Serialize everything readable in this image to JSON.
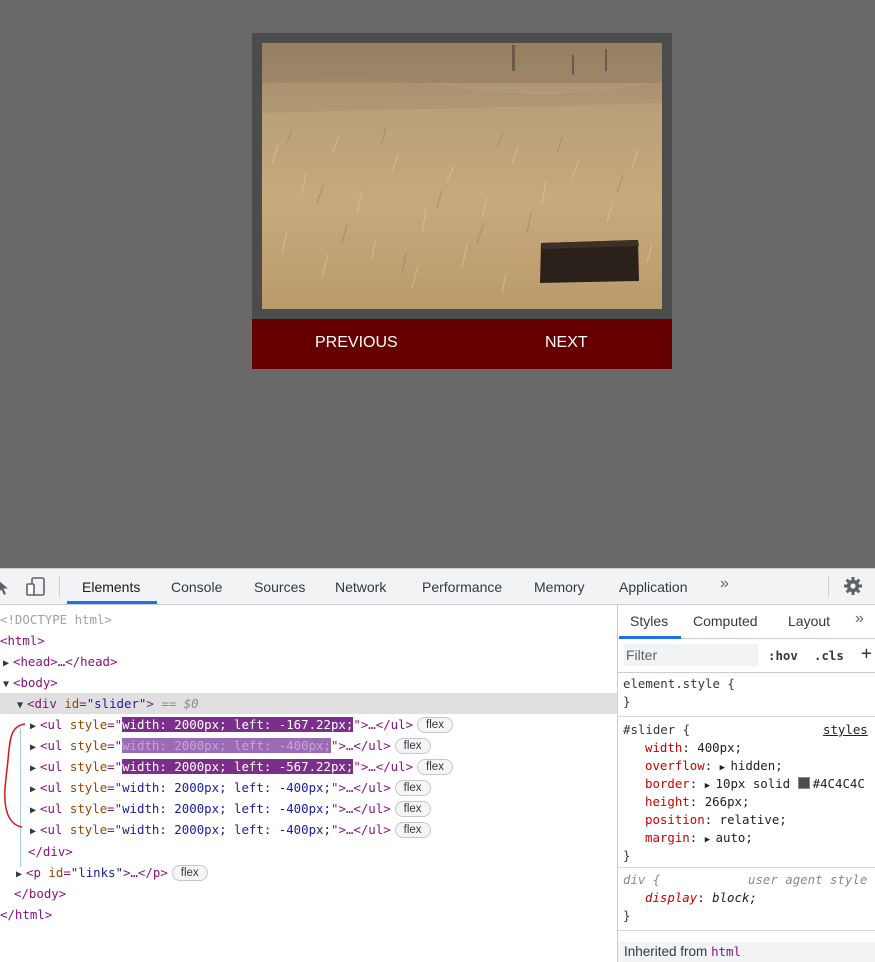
{
  "page": {
    "background_color": "#696969",
    "slider_border_color": "#4C4C4C",
    "links_background": "#660000",
    "prev_label": "PREVIOUS",
    "next_label": "NEXT"
  },
  "devtools": {
    "tabs": [
      {
        "label": "Elements",
        "active": true
      },
      {
        "label": "Console"
      },
      {
        "label": "Sources"
      },
      {
        "label": "Network"
      },
      {
        "label": "Performance"
      },
      {
        "label": "Memory"
      },
      {
        "label": "Application"
      }
    ],
    "more_tabs": "»",
    "dom": {
      "doctype": "<!DOCTYPE html>",
      "html_open": "<html>",
      "head_open": "<head>",
      "head_close": "</head>",
      "ellipsis": "…",
      "body_open": "<body>",
      "div_tag": "div",
      "div_id_attr": "id",
      "div_id_val": "\"slider\"",
      "dollar_zero": "== $0",
      "ul_rows": [
        {
          "style": "width: 2000px; left: -167.22px;"
        },
        {
          "style": "width: 2000px; left: -400px;"
        },
        {
          "style": "width: 2000px; left: -567.22px;"
        },
        {
          "style": "width: 2000px; left: -400px;"
        },
        {
          "style": "width: 2000px; left: -400px;"
        },
        {
          "style": "width: 2000px; left: -400px;"
        }
      ],
      "ul_open_prefix": "<ul",
      "ul_style_attr": "style",
      "ul_close": ">…</ul>",
      "flex_badge": "flex",
      "div_close": "</div>",
      "p_tag": "p",
      "p_id_val": "\"links\"",
      "p_close": ">…</p>",
      "body_close": "</body>",
      "html_close": "</html>"
    },
    "styles": {
      "tabs": [
        "Styles",
        "Computed",
        "Layout"
      ],
      "more": "»",
      "filter_placeholder": "Filter",
      "hov": ":hov",
      "cls": ".cls",
      "plus": "+",
      "element_style": "element.style {",
      "close_brace": "}",
      "slider_selector": "#slider {",
      "slider_source": "styles",
      "slider_props": [
        {
          "name": "width",
          "value": "400px;"
        },
        {
          "name": "overflow",
          "value": "hidden;",
          "expand": true
        },
        {
          "name": "border",
          "value": "10px solid",
          "expand": true,
          "swatch": true,
          "after": "#4C4C4C"
        },
        {
          "name": "height",
          "value": "266px;"
        },
        {
          "name": "position",
          "value": "relative;"
        },
        {
          "name": "margin",
          "value": "auto;",
          "expand": true
        }
      ],
      "div_selector": "div {",
      "div_source": "user agent style",
      "div_prop": {
        "name": "display",
        "value": "block;"
      },
      "inherited_label": "Inherited from",
      "inherited_tag": "html"
    }
  }
}
